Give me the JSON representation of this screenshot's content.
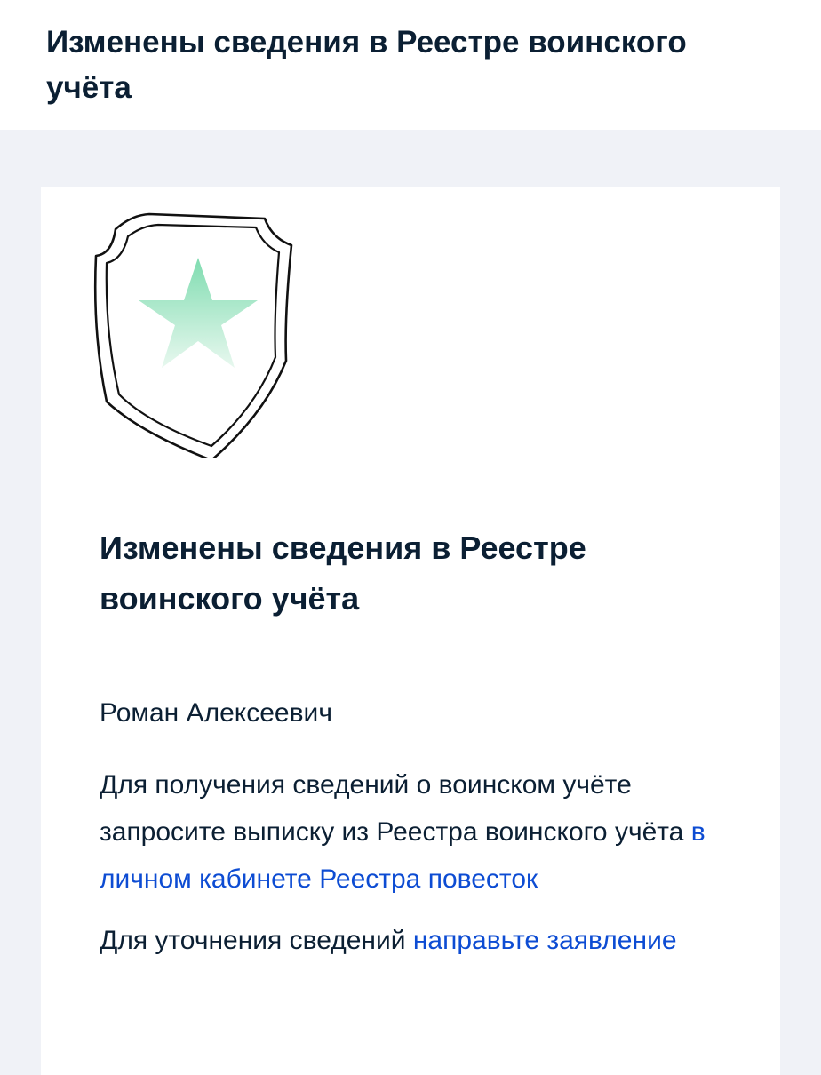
{
  "header": {
    "title": "Изменены сведения в Реестре воинского учёта"
  },
  "card": {
    "emblem_icon": "shield-star-icon",
    "title": "Изменены сведения в Реестре воинского учёта",
    "greeting": "Роман Алексеевич",
    "para1": {
      "text": "Для получения сведений о воинском учёте запросите выписку из Реестра воинского учёта ",
      "link": "в личном кабинете Реестра повесток"
    },
    "para2": {
      "text": "Для уточнения сведений ",
      "link": "направьте заявление"
    }
  },
  "colors": {
    "text": "#0b1f33",
    "link": "#0d4cd3",
    "background": "#f0f2f7",
    "star": "#7fdcb0"
  }
}
